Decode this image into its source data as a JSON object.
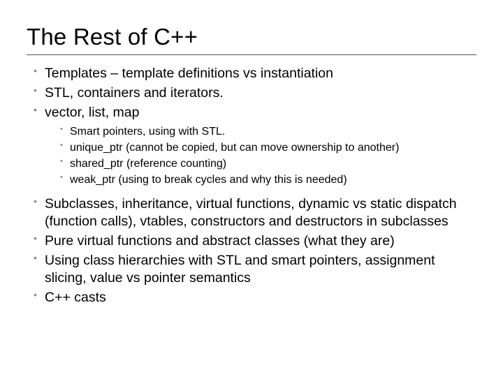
{
  "slide": {
    "title": "The Rest of C++",
    "group1": [
      "Templates – template definitions vs instantiation",
      "STL, containers and iterators.",
      "vector, list, map"
    ],
    "sub": [
      "Smart pointers, using with STL.",
      "unique_ptr (cannot be copied, but can move ownership to another)",
      "shared_ptr (reference counting)",
      "weak_ptr (using to break cycles and why this is needed)"
    ],
    "group2": [
      "Subclasses, inheritance, virtual functions, dynamic vs static dispatch (function calls), vtables, constructors and destructors in subclasses",
      "Pure virtual functions and abstract classes (what they are)",
      "Using class hierarchies with STL and smart pointers, assignment slicing, value vs pointer semantics",
      "C++ casts"
    ]
  }
}
